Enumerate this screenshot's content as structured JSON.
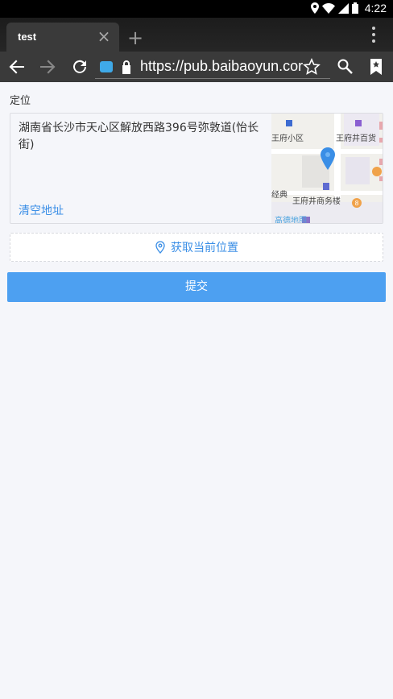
{
  "status_bar": {
    "time": "4:22",
    "icons": [
      "location-icon",
      "wifi-icon",
      "signal-icon",
      "battery-icon"
    ]
  },
  "browser": {
    "tab_title": "test",
    "new_tab_symbol": "+",
    "close_symbol": "×",
    "url": "https://pub.baibaoyun.com",
    "url_display": "https://pub.baibaoyun.cor"
  },
  "page": {
    "field_label": "定位",
    "address": "湖南省长沙市天心区解放西路396号弥敦道(怡长街)",
    "clear_label": "清空地址",
    "get_location_label": "获取当前位置",
    "submit_label": "提交"
  },
  "map": {
    "labels": [
      "王府小区",
      "王府井百货",
      "王府井商务楼",
      "经典"
    ],
    "watermark": "高德地图",
    "route_number": "8",
    "pin_color": "#3a8ee6"
  },
  "colors": {
    "accent": "#3a8ee6",
    "submit_bg": "#4da0f1",
    "toolbar_bg": "#3a3a3a"
  }
}
